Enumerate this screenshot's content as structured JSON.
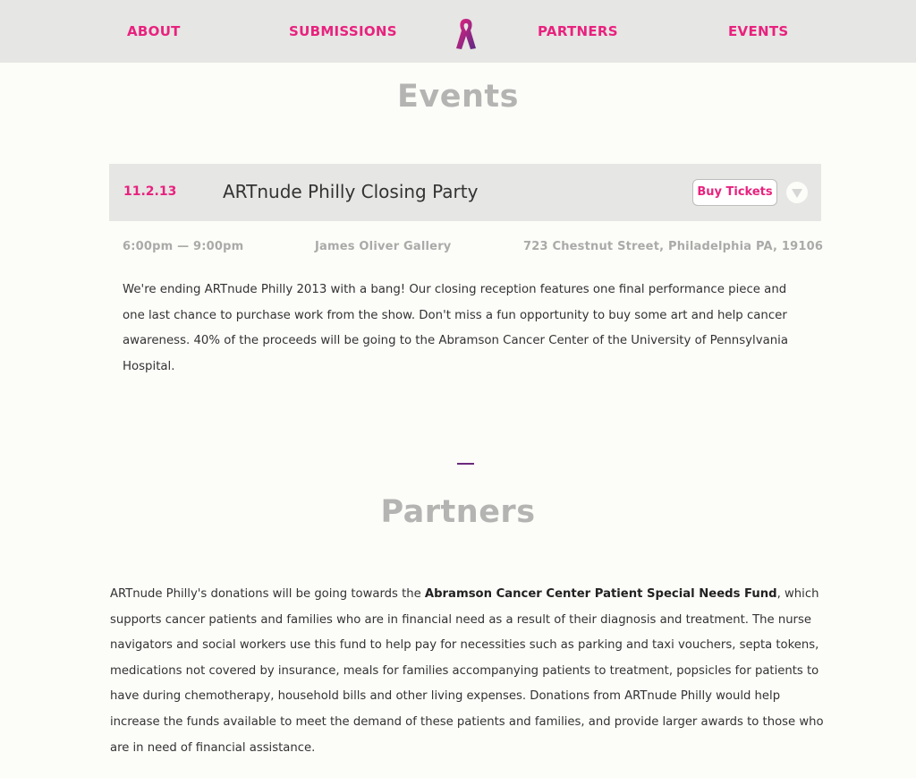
{
  "nav": {
    "about": "ABOUT",
    "submissions": "SUBMISSIONS",
    "partners": "PARTNERS",
    "events": "EVENTS",
    "logo_icon": "awareness-ribbon-icon"
  },
  "events": {
    "title": "Events",
    "item": {
      "date": "11.2.13",
      "name": "ARTnude Philly Closing Party",
      "buy_label": "Buy Tickets",
      "expand_icon": "chevron-down-circle-icon",
      "time": "6:00pm — 9:00pm",
      "venue": "James Oliver Gallery",
      "address": "723 Chestnut Street, Philadelphia PA, 19106",
      "description": "We're ending ARTnude Philly 2013 with a bang! Our closing reception features one final performance piece and one last chance to purchase work from the show. Don't miss a fun opportunity to buy some art and help cancer awareness. 40% of the proceeds will be going to the Abramson Cancer Center of the University of Pennsylvania Hospital."
    }
  },
  "partners": {
    "title": "Partners",
    "text_before": "ARTnude Philly's donations will be going towards the ",
    "fund_name": "Abramson Cancer Center Patient Special Needs Fund",
    "text_after": ", which supports cancer patients and families who are in financial need as a result of their diagnosis and treatment. The nurse navigators and social workers use this fund to help pay for necessities such as parking and taxi vouchers, septa tokens, medications not covered by insurance, meals for families accompanying patients to treatment, popsicles for patients to have during chemotherapy, household bills and other living expenses. Donations from ARTnude Philly would help increase the funds available to meet the demand of these patients and families, and provide larger awards to those who are in need of financial assistance."
  },
  "colors": {
    "accent": "#e8227e",
    "ribbon_purple": "#6b2a7d",
    "heading_gray": "#b4b4b2",
    "bar_gray": "#e6e6e4"
  }
}
